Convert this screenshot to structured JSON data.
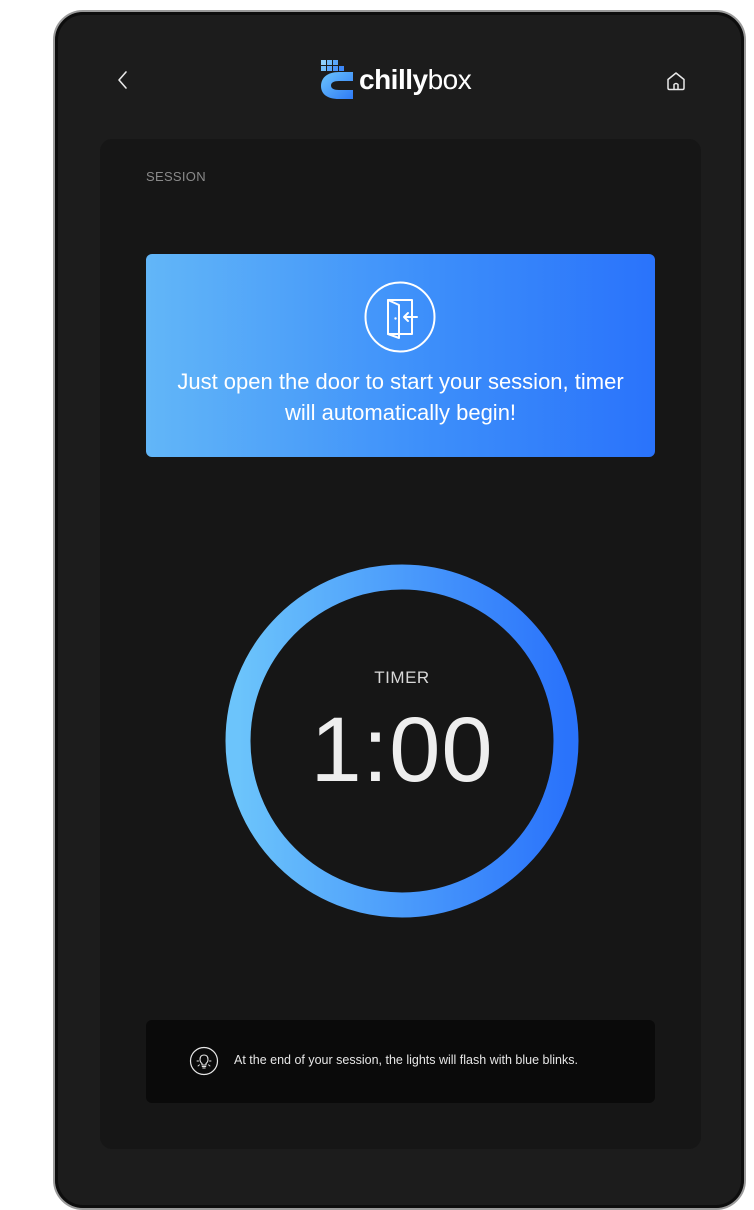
{
  "header": {
    "back_icon": "chevron-left-icon",
    "home_icon": "home-icon",
    "logo": {
      "bold": "chilly",
      "light": "box",
      "brand_color": "#2f7bf7"
    }
  },
  "session": {
    "section_label": "SESSION",
    "info_card": {
      "icon": "door-enter-icon",
      "message": "Just open the door to start your session, timer will automatically begin!",
      "gradient_start": "#62b6f8",
      "gradient_end": "#2a73fb"
    },
    "timer": {
      "label": "TIMER",
      "value": "1:00",
      "ring_start_color": "#6cc4fb",
      "ring_end_color": "#2a73fb"
    },
    "notice": {
      "icon": "lightbulb-icon",
      "text": "At the end of your session, the lights will flash with blue blinks."
    }
  }
}
